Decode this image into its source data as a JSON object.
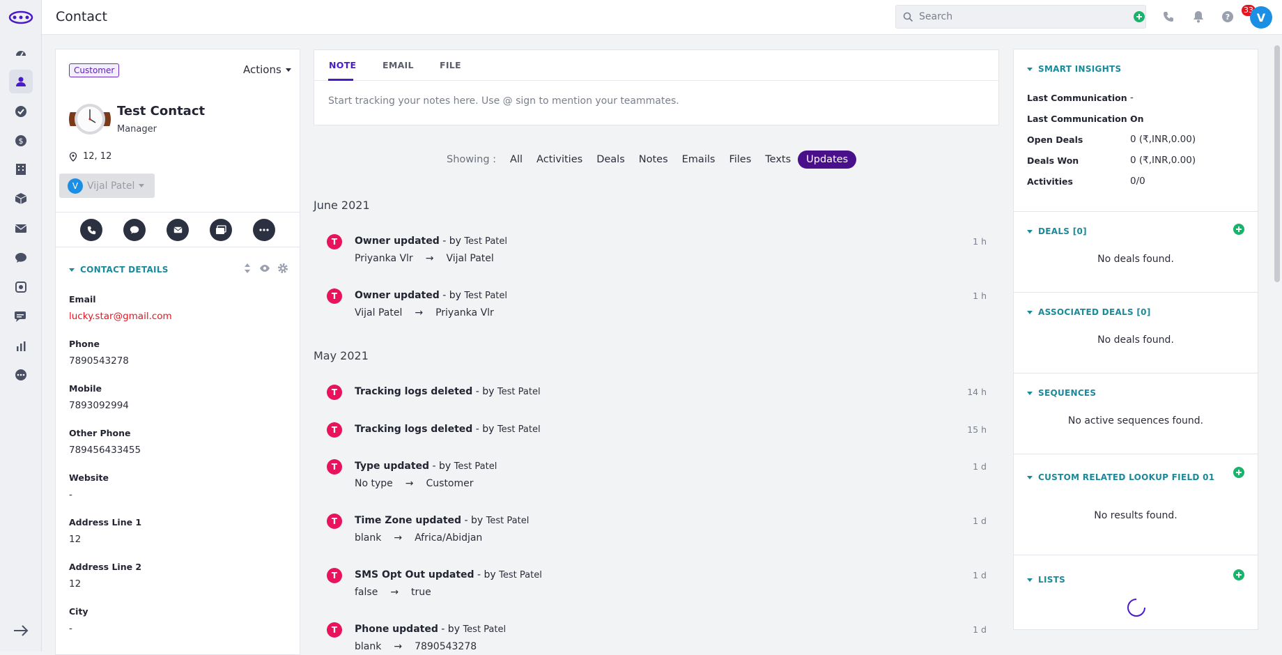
{
  "app": {
    "page_title": "Contact",
    "search_placeholder": "Search",
    "notification_count": "33",
    "user_initial": "V"
  },
  "nav": [
    "dashboard-icon",
    "contacts-icon",
    "tasks-icon",
    "deals-icon",
    "companies-icon",
    "products-icon",
    "email-icon",
    "chat-icon",
    "automation-icon",
    "sms-icon",
    "reports-icon",
    "more-icon"
  ],
  "contact": {
    "tag": "Customer",
    "actions_label": "Actions",
    "name": "Test Contact",
    "role": "Manager",
    "location": "12, 12",
    "owner_initial": "V",
    "owner_name": "Vijal Patel",
    "details_title": "CONTACT DETAILS",
    "fields": [
      {
        "label": "Email",
        "value": "lucky.star@gmail.com"
      },
      {
        "label": "Phone",
        "value": "7890543278"
      },
      {
        "label": "Mobile",
        "value": "7893092994"
      },
      {
        "label": "Other Phone",
        "value": "789456433455"
      },
      {
        "label": "Website",
        "value": "-"
      },
      {
        "label": "Address Line 1",
        "value": "12"
      },
      {
        "label": "Address Line 2",
        "value": "12"
      },
      {
        "label": "City",
        "value": "-"
      }
    ]
  },
  "composer": {
    "tabs": [
      "NOTE",
      "EMAIL",
      "FILE"
    ],
    "placeholder": "Start tracking your notes here. Use @ sign to mention your teammates."
  },
  "filters": {
    "label": "Showing :",
    "items": [
      "All",
      "Activities",
      "Deals",
      "Notes",
      "Emails",
      "Files",
      "Texts",
      "Updates"
    ],
    "active": "Updates"
  },
  "timeline": {
    "months": [
      "June 2021",
      "May 2021"
    ],
    "events": [
      {
        "initial": "T",
        "title": "Owner updated",
        "by": " - by ",
        "user": "Test Patel",
        "time": "1 h",
        "from": "Priyanka Vlr",
        "to": "Vijal Patel"
      },
      {
        "initial": "T",
        "title": "Owner updated",
        "by": " - by ",
        "user": "Test Patel",
        "time": "1 h",
        "from": "Vijal Patel",
        "to": "Priyanka Vlr"
      },
      {
        "initial": "T",
        "title": "Tracking logs deleted",
        "by": " - by ",
        "user": "Test Patel",
        "time": "14 h"
      },
      {
        "initial": "T",
        "title": "Tracking logs deleted",
        "by": " - by ",
        "user": "Test Patel",
        "time": "15 h"
      },
      {
        "initial": "T",
        "title": "Type updated",
        "by": " - by ",
        "user": "Test Patel",
        "time": "1 d",
        "from": "No type",
        "to": "Customer"
      },
      {
        "initial": "T",
        "title": "Time Zone updated",
        "by": " - by ",
        "user": "Test Patel",
        "time": "1 d",
        "from": "blank",
        "to": "Africa/Abidjan"
      },
      {
        "initial": "T",
        "title": "SMS Opt Out updated",
        "by": " - by ",
        "user": "Test Patel",
        "time": "1 d",
        "from": "false",
        "to": "true"
      },
      {
        "initial": "T",
        "title": "Phone updated",
        "by": " - by ",
        "user": "Test Patel",
        "time": "1 d",
        "from": "blank",
        "to": "7890543278"
      }
    ],
    "arrow": "→"
  },
  "insights": {
    "title": "SMART INSIGHTS",
    "rows": [
      {
        "label": "Last Communication",
        "value": "-"
      },
      {
        "label": "Last Communication On",
        "value": "-"
      },
      {
        "label": "Open Deals",
        "value": "0 (₹,INR,0.00)"
      },
      {
        "label": "Deals Won",
        "value": "0 (₹,INR,0.00)"
      },
      {
        "label": "Activities",
        "value": "0/0"
      }
    ]
  },
  "panels": {
    "deals": {
      "title": "DEALS [0]",
      "empty": "No deals found."
    },
    "assoc": {
      "title": "ASSOCIATED DEALS [0]",
      "empty": "No deals found."
    },
    "seq": {
      "title": "SEQUENCES",
      "empty": "No active sequences found."
    },
    "custom": {
      "title": "CUSTOM RELATED LOOKUP FIELD 01",
      "empty": "No results found."
    },
    "lists": {
      "title": "LISTS"
    }
  },
  "colors": {
    "accent": "#4a19c8",
    "teal": "#1a8a9a",
    "event_dot": "#e8135b",
    "add": "#19b36b"
  }
}
